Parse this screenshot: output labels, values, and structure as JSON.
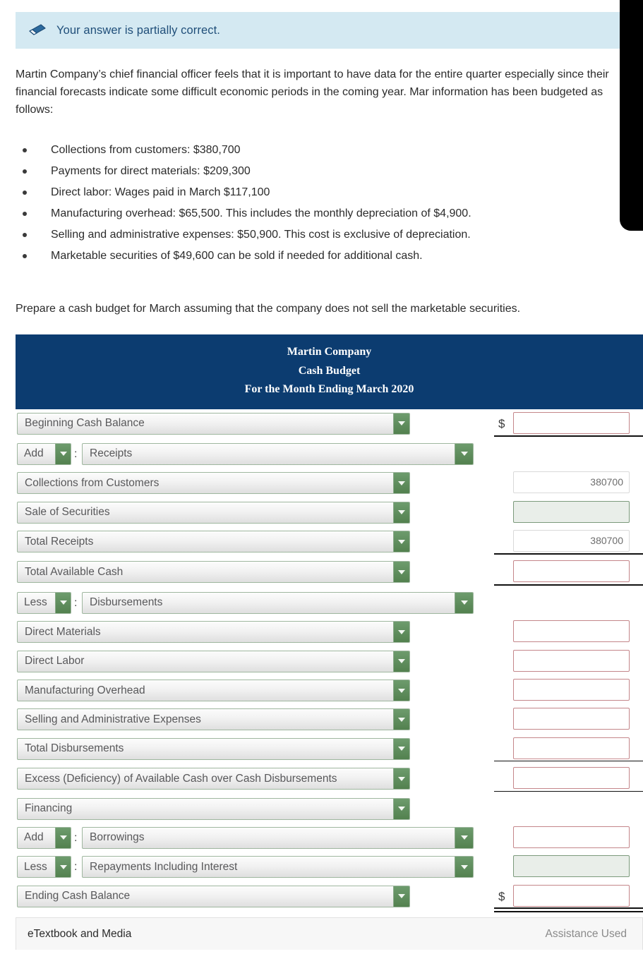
{
  "banner": {
    "icon": "eraser-icon",
    "message": "Your answer is partially correct.",
    "bg_color": "#d4e9f2",
    "text_color": "#1f4e79"
  },
  "intro": {
    "paragraph": "Martin Company’s chief financial officer feels that it is important to have data for the entire quarter especially since their financial forecasts indicate some difficult economic periods in the coming year. Mar information has been budgeted as follows:"
  },
  "bullets": [
    "Collections from customers: $380,700",
    "Payments for direct materials: $209,300",
    "Direct labor: Wages paid in March $117,100",
    "Manufacturing overhead: $65,500. This includes the monthly depreciation of $4,900.",
    "Selling and administrative expenses: $50,900. This cost is exclusive of depreciation.",
    "Marketable securities of $49,600 can be sold if needed for additional cash."
  ],
  "prepare": {
    "text": "Prepare a cash budget for March assuming that the company does not sell the marketable securities."
  },
  "table": {
    "header_bg": "#0c3c70",
    "title_lines": [
      "Martin Company",
      "Cash Budget",
      "For the Month Ending March 2020"
    ],
    "rows": [
      {
        "type": "single",
        "label": "Beginning Cash Balance",
        "dollar": "$",
        "input": {
          "state": "empty",
          "value": ""
        }
      },
      {
        "type": "group",
        "op": "Add",
        "colon": ":",
        "label": "Receipts",
        "input": {
          "state": "none",
          "value": ""
        }
      },
      {
        "type": "single",
        "label": "Collections from Customers",
        "input": {
          "state": "filled",
          "value": "380700"
        }
      },
      {
        "type": "single",
        "label": "Sale of Securities",
        "input": {
          "state": "disabled",
          "value": ""
        }
      },
      {
        "type": "single",
        "label": "Total Receipts",
        "input": {
          "state": "filled",
          "value": "380700"
        }
      },
      {
        "type": "single",
        "label": "Total Available Cash",
        "input": {
          "state": "empty",
          "value": ""
        }
      },
      {
        "type": "group",
        "op": "Less",
        "colon": ":",
        "label": "Disbursements",
        "input": {
          "state": "none",
          "value": ""
        }
      },
      {
        "type": "single",
        "label": "Direct Materials",
        "input": {
          "state": "empty",
          "value": ""
        }
      },
      {
        "type": "single",
        "label": "Direct Labor",
        "input": {
          "state": "empty",
          "value": ""
        }
      },
      {
        "type": "single",
        "label": "Manufacturing Overhead",
        "input": {
          "state": "empty",
          "value": ""
        }
      },
      {
        "type": "single",
        "label": "Selling and Administrative Expenses",
        "input": {
          "state": "empty",
          "value": ""
        }
      },
      {
        "type": "single",
        "label": "Total Disbursements",
        "input": {
          "state": "empty",
          "value": ""
        }
      },
      {
        "type": "single",
        "label": "Excess (Deficiency) of Available Cash over Cash Disbursements",
        "input": {
          "state": "empty",
          "value": ""
        }
      },
      {
        "type": "single",
        "label": "Financing",
        "input": {
          "state": "none",
          "value": ""
        }
      },
      {
        "type": "group",
        "op": "Add",
        "colon": ":",
        "label": "Borrowings",
        "input": {
          "state": "empty",
          "value": ""
        }
      },
      {
        "type": "group",
        "op": "Less",
        "colon": ":",
        "label": "Repayments Including Interest",
        "input": {
          "state": "disabled",
          "value": ""
        }
      },
      {
        "type": "single",
        "label": "Ending Cash Balance",
        "dollar": "$",
        "input": {
          "state": "empty",
          "value": ""
        }
      }
    ]
  },
  "footer": {
    "etextbook_label": "eTextbook and Media",
    "assistance_label": "Assistance Used"
  }
}
